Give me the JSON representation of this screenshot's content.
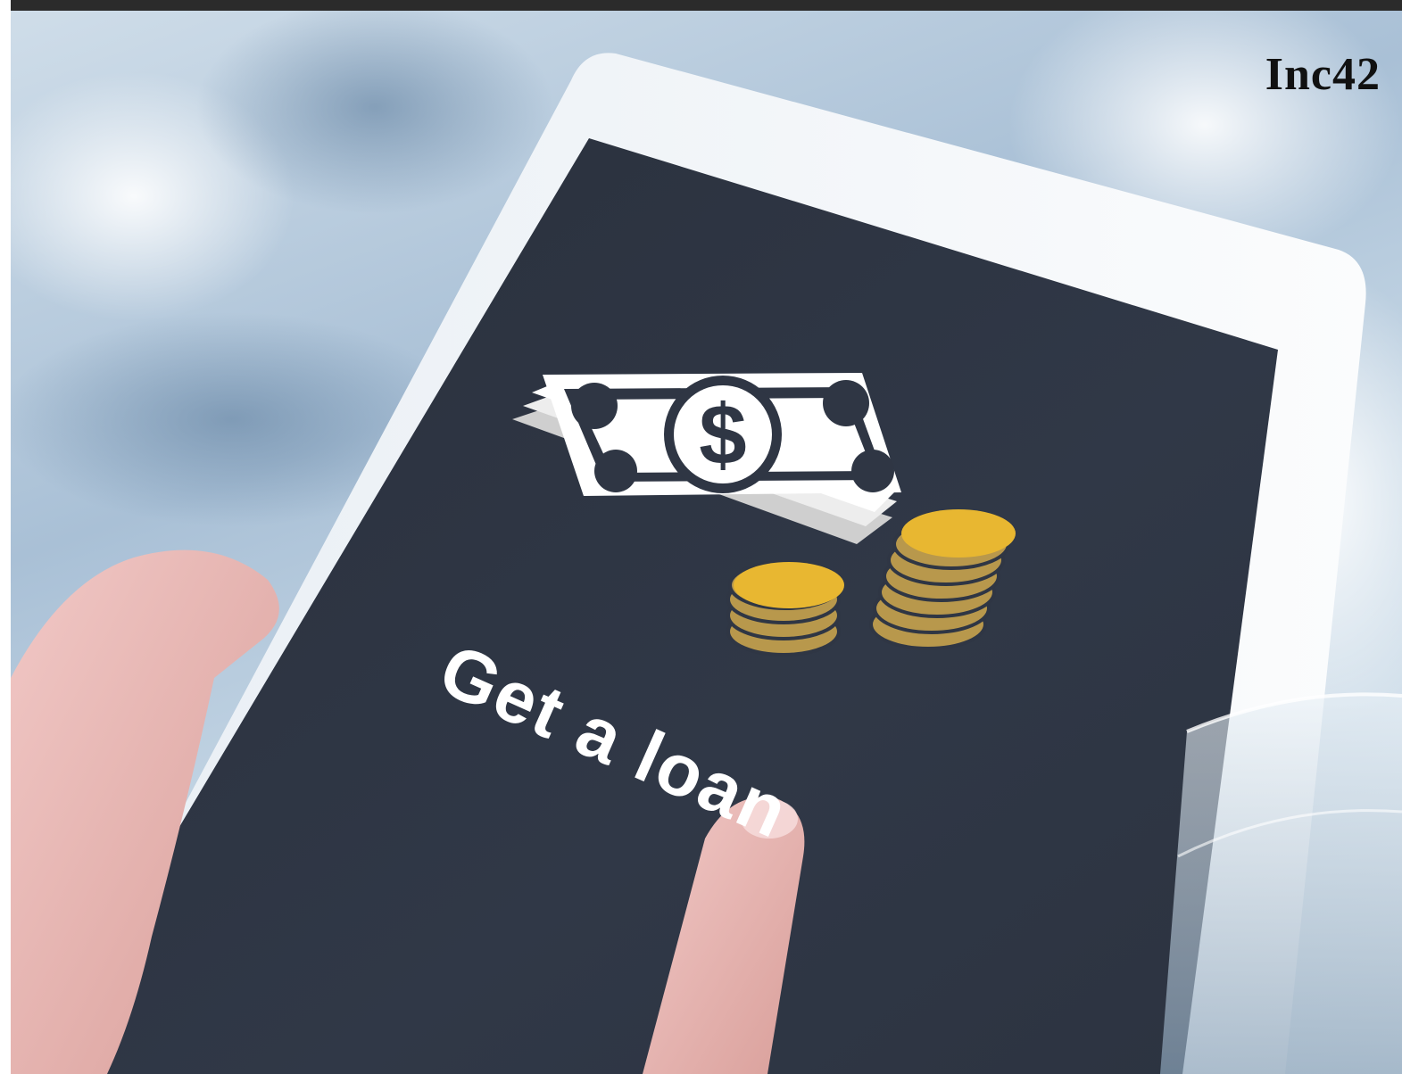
{
  "logo": {
    "text": "Inc42"
  },
  "screen": {
    "text": "Get a loan"
  },
  "icons": [
    "cash-stack-icon",
    "dollar-icon",
    "coin-stack-icon"
  ],
  "colors": {
    "screen": "#2f3644",
    "bezel": "#f3f6f9",
    "coin": "#e8b731",
    "coin_shadow": "#b8984c"
  }
}
